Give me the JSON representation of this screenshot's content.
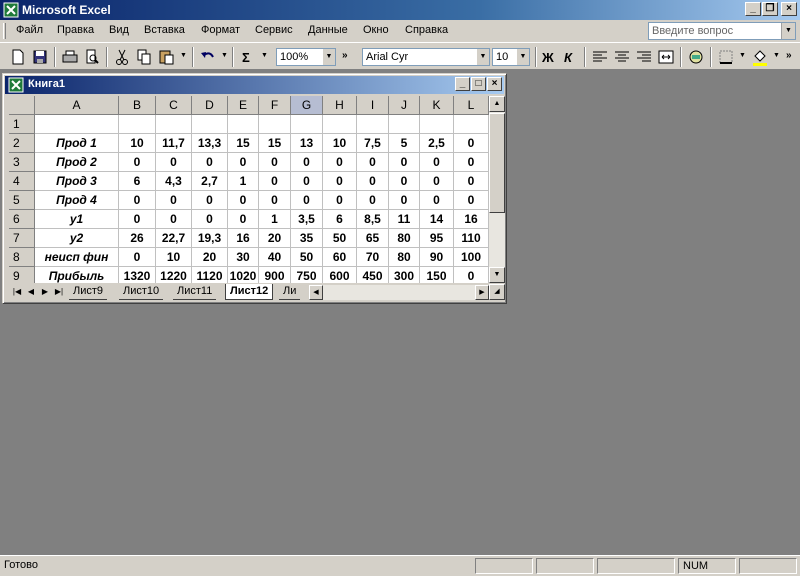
{
  "window": {
    "title": "Microsoft Excel"
  },
  "menu": {
    "items": [
      "Файл",
      "Правка",
      "Вид",
      "Вставка",
      "Формат",
      "Сервис",
      "Данные",
      "Окно",
      "Справка"
    ],
    "ask_placeholder": "Введите вопрос"
  },
  "toolbar": {
    "zoom": "100%",
    "font_name": "Arial Cyr",
    "font_size": "10",
    "bold_label": "Ж",
    "italic_label": "К",
    "sum_label": "Σ"
  },
  "workbook": {
    "title": "Книга1",
    "columns": [
      "A",
      "B",
      "C",
      "D",
      "E",
      "F",
      "G",
      "H",
      "I",
      "J",
      "K",
      "L"
    ],
    "selected_column": "G",
    "rows": [
      {
        "num": "1",
        "label": "",
        "values": [
          "",
          "",
          "",
          "",
          "",
          "",
          "",
          "",
          "",
          "",
          ""
        ]
      },
      {
        "num": "2",
        "label": "Прод 1",
        "values": [
          "10",
          "11,7",
          "13,3",
          "15",
          "15",
          "13",
          "10",
          "7,5",
          "5",
          "2,5",
          "0"
        ]
      },
      {
        "num": "3",
        "label": "Прод 2",
        "values": [
          "0",
          "0",
          "0",
          "0",
          "0",
          "0",
          "0",
          "0",
          "0",
          "0",
          "0"
        ]
      },
      {
        "num": "4",
        "label": "Прод 3",
        "values": [
          "6",
          "4,3",
          "2,7",
          "1",
          "0",
          "0",
          "0",
          "0",
          "0",
          "0",
          "0"
        ]
      },
      {
        "num": "5",
        "label": "Прод 4",
        "values": [
          "0",
          "0",
          "0",
          "0",
          "0",
          "0",
          "0",
          "0",
          "0",
          "0",
          "0"
        ]
      },
      {
        "num": "6",
        "label": "y1",
        "values": [
          "0",
          "0",
          "0",
          "0",
          "1",
          "3,5",
          "6",
          "8,5",
          "11",
          "14",
          "16"
        ]
      },
      {
        "num": "7",
        "label": "y2",
        "values": [
          "26",
          "22,7",
          "19,3",
          "16",
          "20",
          "35",
          "50",
          "65",
          "80",
          "95",
          "110"
        ]
      },
      {
        "num": "8",
        "label": "неисп фин",
        "values": [
          "0",
          "10",
          "20",
          "30",
          "40",
          "50",
          "60",
          "70",
          "80",
          "90",
          "100"
        ]
      },
      {
        "num": "9",
        "label": "Прибыль",
        "values": [
          "1320",
          "1220",
          "1120",
          "1020",
          "900",
          "750",
          "600",
          "450",
          "300",
          "150",
          "0"
        ]
      }
    ],
    "sheets": [
      "Лист9",
      "Лист10",
      "Лист11",
      "Лист12",
      "Ли"
    ],
    "active_sheet": "Лист12"
  },
  "status": {
    "ready": "Готово",
    "num": "NUM"
  }
}
